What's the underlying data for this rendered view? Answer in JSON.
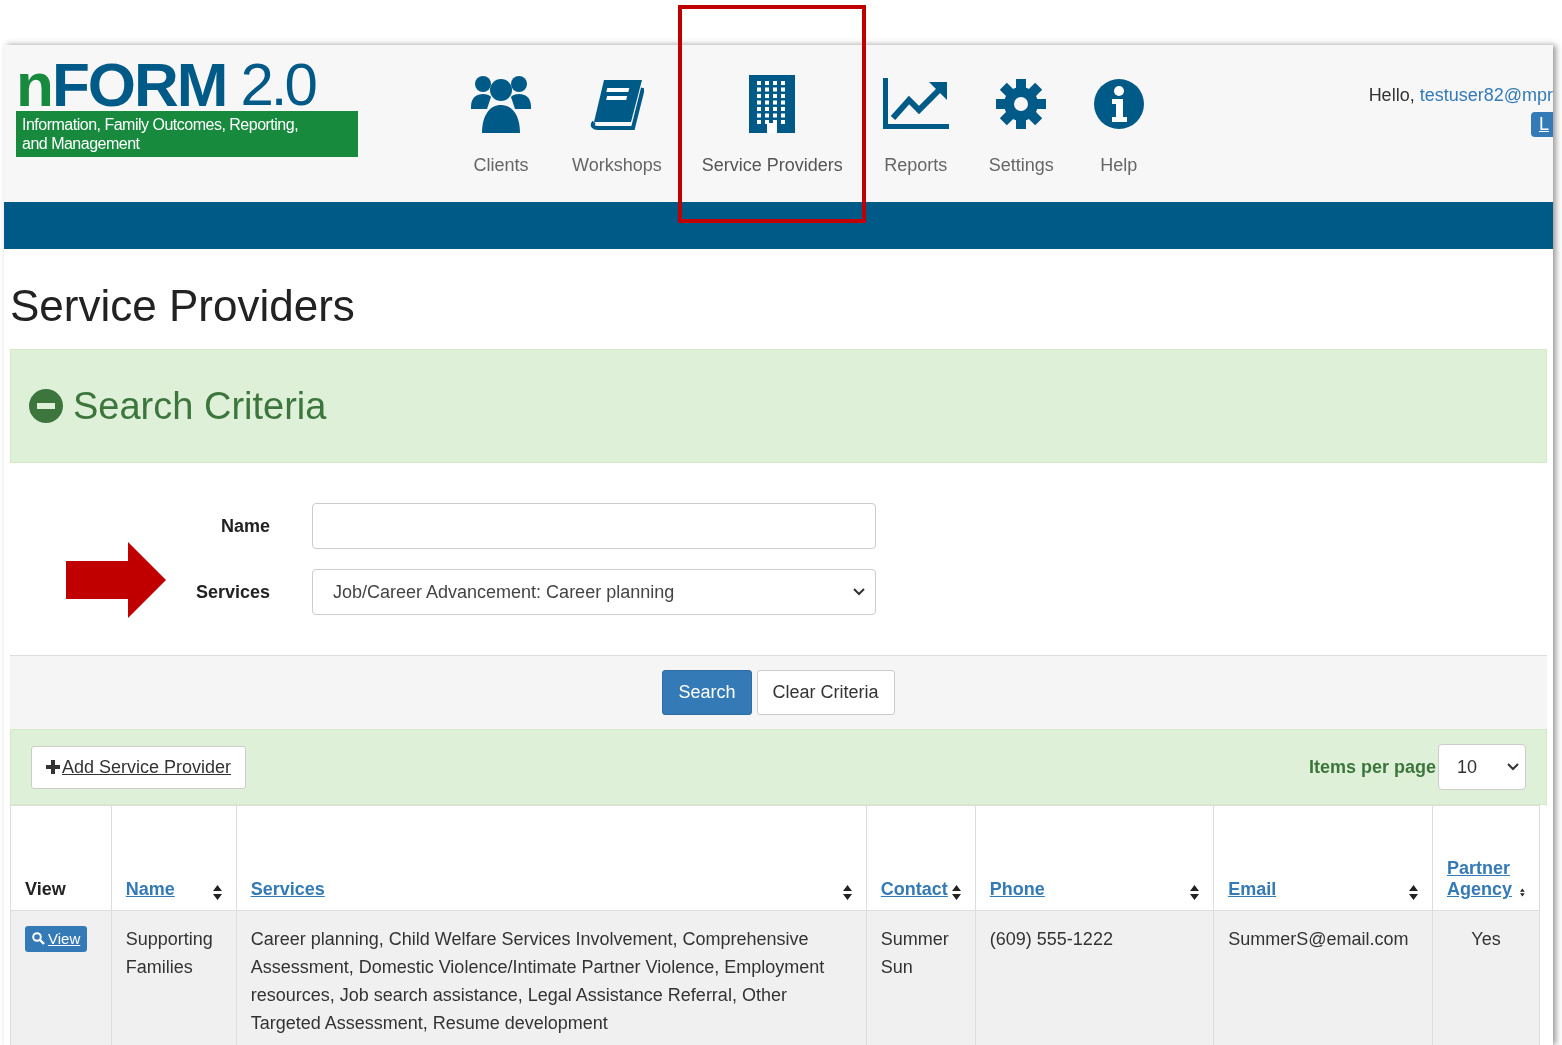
{
  "logo": {
    "wordmark_lead": "n",
    "wordmark": "FORM",
    "version": "2.0",
    "tagline": "Information, Family Outcomes, Reporting, and Management"
  },
  "nav": [
    {
      "label": "Clients",
      "selected": false
    },
    {
      "label": "Workshops",
      "selected": false
    },
    {
      "label": "Service Providers",
      "selected": true
    },
    {
      "label": "Reports",
      "selected": false
    },
    {
      "label": "Settings",
      "selected": false
    },
    {
      "label": "Help",
      "selected": false
    }
  ],
  "user": {
    "greeting": "Hello,",
    "email": "testuser82@mpr",
    "logout": "L"
  },
  "page_title": "Service Providers",
  "search_panel": {
    "title": "Search Criteria",
    "expanded": true,
    "fields": [
      {
        "label": "Name",
        "kind": "text"
      },
      {
        "label": "Services",
        "kind": "select",
        "value": "Job/Career Advancement: Career planning",
        "highlighted": true
      }
    ],
    "buttons": [
      {
        "label": "Search",
        "primary": true
      },
      {
        "label": "Clear Criteria",
        "primary": false
      }
    ]
  },
  "table_toolbar": {
    "add_button": "Add Service Provider",
    "items_per_page_label": "Items per page",
    "items_per_page": "10"
  },
  "table": {
    "columns": [
      {
        "label": "View",
        "sortable": false
      },
      {
        "label": "Name",
        "sortable": true
      },
      {
        "label": "Services",
        "sortable": true
      },
      {
        "label": "Contact",
        "sortable": true
      },
      {
        "label": "Phone",
        "sortable": true
      },
      {
        "label": "Email",
        "sortable": true
      },
      {
        "label": "Partner Agency",
        "sortable": true
      }
    ],
    "rows": [
      {
        "cells": [
          "View",
          "Supporting Families",
          "Career planning, Child Welfare Services Involvement, Comprehensive Assessment, Domestic Violence/Intimate Partner Violence, Employment resources, Job search assistance, Legal Assistance Referral, Other Targeted Assessment, Resume development",
          "Summer Sun",
          "(609) 555-1222",
          "SummerS@email.com",
          "Yes"
        ]
      }
    ]
  }
}
